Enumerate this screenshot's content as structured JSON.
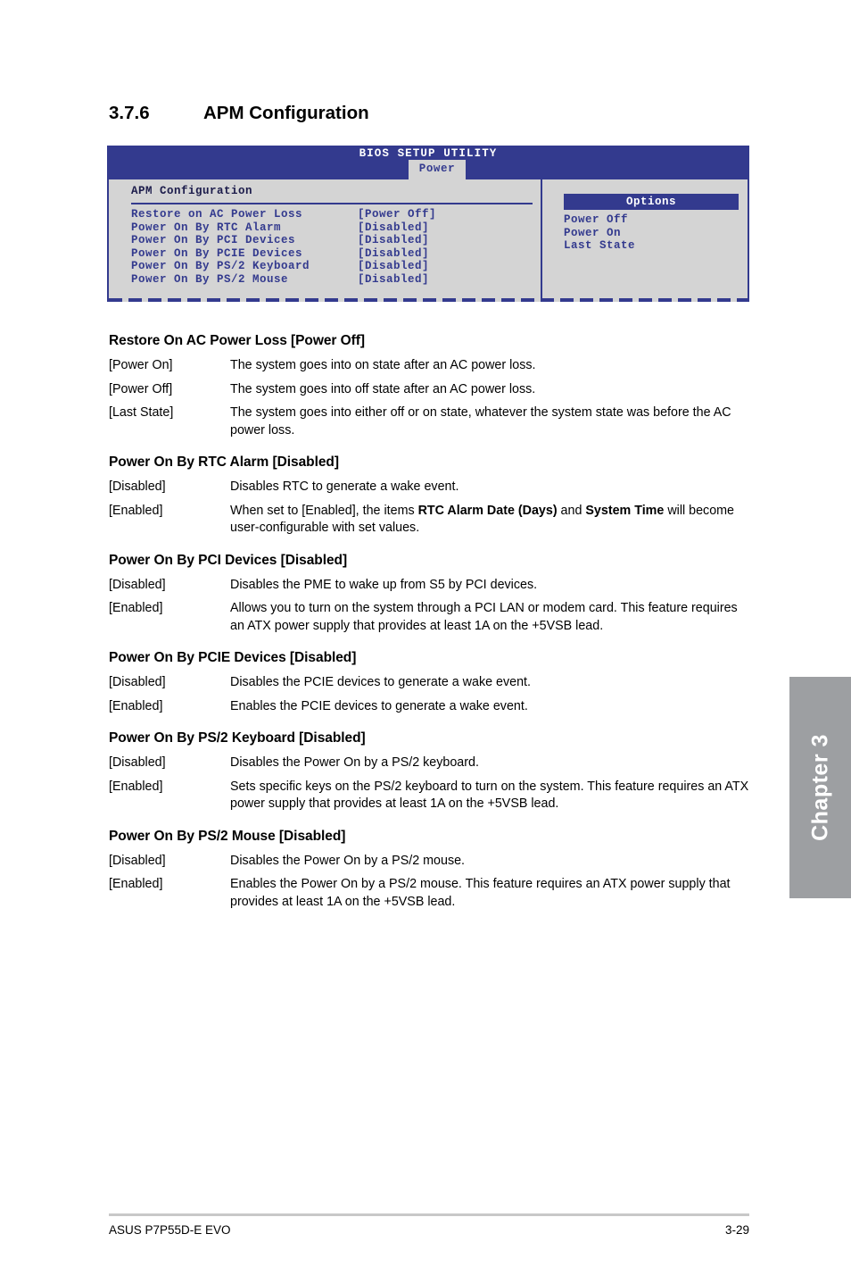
{
  "section": {
    "number": "3.7.6",
    "title": "APM Configuration"
  },
  "bios_screenshot": {
    "utility_title": "BIOS SETUP UTILITY",
    "active_tab": "Power",
    "panel_heading": "APM Configuration",
    "settings": [
      {
        "label": "Restore on AC Power Loss",
        "value": "[Power Off]"
      },
      {
        "label": "Power On By RTC Alarm",
        "value": "[Disabled]"
      },
      {
        "label": "Power On By PCI Devices",
        "value": "[Disabled]"
      },
      {
        "label": "Power On By PCIE Devices",
        "value": "[Disabled]"
      },
      {
        "label": "Power On By PS/2 Keyboard",
        "value": "[Disabled]"
      },
      {
        "label": "Power On By PS/2 Mouse",
        "value": "[Disabled]"
      }
    ],
    "options_header": "Options",
    "options": [
      "Power Off",
      "Power On",
      "Last State"
    ],
    "colors": {
      "bios_blue": "#333a8e",
      "bios_gray": "#d4d4d4",
      "bios_white": "#ffffff"
    }
  },
  "items": [
    {
      "title": "Restore On AC Power Loss [Power Off]",
      "defs": [
        {
          "term": "[Power On]",
          "desc_html": "The system goes into on state after an AC power loss."
        },
        {
          "term": "[Power Off]",
          "desc_html": "The system goes into off state after an AC power loss."
        },
        {
          "term": "[Last State]",
          "desc_html": "The system goes into either off or on state, whatever the system state was before the AC power loss."
        }
      ]
    },
    {
      "title": "Power On By RTC Alarm [Disabled]",
      "defs": [
        {
          "term": "[Disabled]",
          "desc_html": "Disables RTC to generate a wake event."
        },
        {
          "term": "[Enabled]",
          "desc_html": "When set to [Enabled], the items <b>RTC Alarm Date (Days)</b> and <b>System Time</b> will become user-configurable with set values."
        }
      ]
    },
    {
      "title": "Power On By PCI Devices [Disabled]",
      "defs": [
        {
          "term": "[Disabled]",
          "desc_html": "Disables the PME to wake up from S5 by PCI devices."
        },
        {
          "term": "[Enabled]",
          "desc_html": "Allows you to turn on the system through a PCI LAN or modem card. This feature requires an ATX power supply that provides at least 1A on the +5VSB lead."
        }
      ]
    },
    {
      "title": "Power On By PCIE Devices [Disabled]",
      "defs": [
        {
          "term": "[Disabled]",
          "desc_html": "Disables the PCIE devices to generate a wake event."
        },
        {
          "term": "[Enabled]",
          "desc_html": "Enables the PCIE devices to generate a wake event."
        }
      ]
    },
    {
      "title": "Power On By PS/2 Keyboard [Disabled]",
      "defs": [
        {
          "term": "[Disabled]",
          "desc_html": "Disables the Power On by a PS/2 keyboard."
        },
        {
          "term": "[Enabled]",
          "desc_html": "Sets specific keys on the PS/2 keyboard to turn on the system. This feature requires an ATX power supply that provides at least 1A on the +5VSB lead."
        }
      ]
    },
    {
      "title": "Power On By PS/2 Mouse [Disabled]",
      "defs": [
        {
          "term": "[Disabled]",
          "desc_html": "Disables the Power On by a PS/2 mouse."
        },
        {
          "term": "[Enabled]",
          "desc_html": "Enables the Power On by a PS/2 mouse. This feature requires an ATX power supply that provides at least 1A on the +5VSB lead."
        }
      ]
    }
  ],
  "chapter_tab": {
    "label": "Chapter 3",
    "color": "#9d9fa2"
  },
  "footer": {
    "left": "ASUS P7P55D-E EVO",
    "page": "3-29"
  }
}
